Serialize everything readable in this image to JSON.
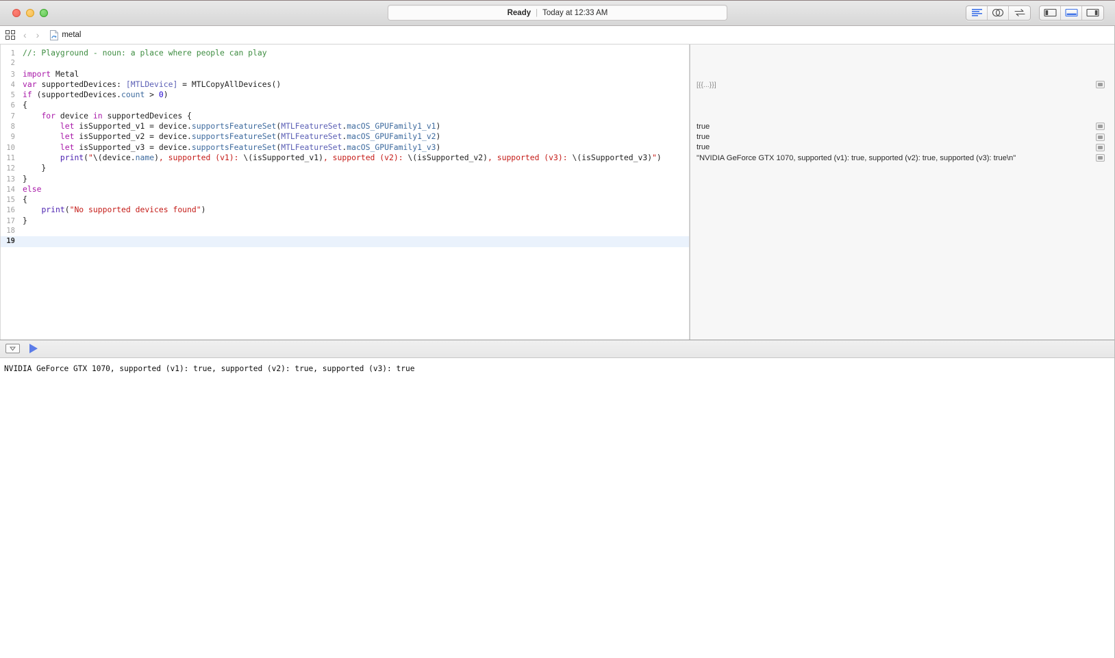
{
  "window": {
    "traffic_lights": [
      "close",
      "minimize",
      "zoom"
    ],
    "status": {
      "state": "Ready",
      "separator": "|",
      "time": "Today at 12:33 AM"
    },
    "toolbar_right": {
      "editor_modes": [
        {
          "name": "standard-editor",
          "icon": "lines-icon",
          "active": true
        },
        {
          "name": "assistant-editor",
          "icon": "two-circles-icon",
          "active": false
        },
        {
          "name": "version-editor",
          "icon": "arrows-swap-icon",
          "active": false
        }
      ],
      "view_toggles": [
        {
          "name": "navigator-toggle",
          "icon": "left-panel-icon",
          "active": false
        },
        {
          "name": "debug-area-toggle",
          "icon": "bottom-panel-icon",
          "active": true
        },
        {
          "name": "utilities-toggle",
          "icon": "right-panel-icon",
          "active": false
        }
      ]
    }
  },
  "pathbar": {
    "grid_icon": "grid-icon",
    "back_label": "‹",
    "forward_label": "›",
    "file_icon": "playground-file-icon",
    "file_name": "metal"
  },
  "editor": {
    "lines": [
      {
        "n": "1",
        "tokens": [
          {
            "t": "//: Playground - noun: a place where people can play",
            "c": "cmt"
          }
        ]
      },
      {
        "n": "2",
        "tokens": []
      },
      {
        "n": "3",
        "tokens": [
          {
            "t": "import ",
            "c": "k"
          },
          {
            "t": "Metal",
            "c": "pln"
          }
        ]
      },
      {
        "n": "4",
        "tokens": [
          {
            "t": "var ",
            "c": "k"
          },
          {
            "t": "supportedDevices: ",
            "c": "pln"
          },
          {
            "t": "[MTLDevice]",
            "c": "ty"
          },
          {
            "t": " = MTLCopyAllDevices()",
            "c": "pln"
          }
        ]
      },
      {
        "n": "5",
        "tokens": [
          {
            "t": "if ",
            "c": "k"
          },
          {
            "t": "(supportedDevices.",
            "c": "pln"
          },
          {
            "t": "count",
            "c": "mth"
          },
          {
            "t": " > ",
            "c": "pln"
          },
          {
            "t": "0",
            "c": "num"
          },
          {
            "t": ")",
            "c": "pln"
          }
        ]
      },
      {
        "n": "6",
        "tokens": [
          {
            "t": "{",
            "c": "pln"
          }
        ]
      },
      {
        "n": "7",
        "tokens": [
          {
            "t": "    ",
            "c": "pln"
          },
          {
            "t": "for ",
            "c": "k"
          },
          {
            "t": "device ",
            "c": "pln"
          },
          {
            "t": "in ",
            "c": "k"
          },
          {
            "t": "supportedDevices {",
            "c": "pln"
          }
        ]
      },
      {
        "n": "8",
        "tokens": [
          {
            "t": "        ",
            "c": "pln"
          },
          {
            "t": "let ",
            "c": "k"
          },
          {
            "t": "isSupported_v1 = device.",
            "c": "pln"
          },
          {
            "t": "supportsFeatureSet",
            "c": "mth"
          },
          {
            "t": "(",
            "c": "pln"
          },
          {
            "t": "MTLFeatureSet",
            "c": "ty"
          },
          {
            "t": ".",
            "c": "pln"
          },
          {
            "t": "macOS_GPUFamily1_v1",
            "c": "mth"
          },
          {
            "t": ")",
            "c": "pln"
          }
        ]
      },
      {
        "n": "9",
        "tokens": [
          {
            "t": "        ",
            "c": "pln"
          },
          {
            "t": "let ",
            "c": "k"
          },
          {
            "t": "isSupported_v2 = device.",
            "c": "pln"
          },
          {
            "t": "supportsFeatureSet",
            "c": "mth"
          },
          {
            "t": "(",
            "c": "pln"
          },
          {
            "t": "MTLFeatureSet",
            "c": "ty"
          },
          {
            "t": ".",
            "c": "pln"
          },
          {
            "t": "macOS_GPUFamily1_v2",
            "c": "mth"
          },
          {
            "t": ")",
            "c": "pln"
          }
        ]
      },
      {
        "n": "10",
        "tokens": [
          {
            "t": "        ",
            "c": "pln"
          },
          {
            "t": "let ",
            "c": "k"
          },
          {
            "t": "isSupported_v3 = device.",
            "c": "pln"
          },
          {
            "t": "supportsFeatureSet",
            "c": "mth"
          },
          {
            "t": "(",
            "c": "pln"
          },
          {
            "t": "MTLFeatureSet",
            "c": "ty"
          },
          {
            "t": ".",
            "c": "pln"
          },
          {
            "t": "macOS_GPUFamily1_v3",
            "c": "mth"
          },
          {
            "t": ")",
            "c": "pln"
          }
        ]
      },
      {
        "n": "11",
        "tokens": [
          {
            "t": "        ",
            "c": "pln"
          },
          {
            "t": "print",
            "c": "fn"
          },
          {
            "t": "(",
            "c": "pln"
          },
          {
            "t": "\"",
            "c": "str"
          },
          {
            "t": "\\(",
            "c": "pln"
          },
          {
            "t": "device.",
            "c": "pln"
          },
          {
            "t": "name",
            "c": "mth"
          },
          {
            "t": ")",
            "c": "pln"
          },
          {
            "t": ", supported (v1): ",
            "c": "str"
          },
          {
            "t": "\\(",
            "c": "pln"
          },
          {
            "t": "isSupported_v1",
            "c": "pln"
          },
          {
            "t": ")",
            "c": "pln"
          },
          {
            "t": ", supported (v2): ",
            "c": "str"
          },
          {
            "t": "\\(",
            "c": "pln"
          },
          {
            "t": "isSupported_v2",
            "c": "pln"
          },
          {
            "t": ")",
            "c": "pln"
          },
          {
            "t": ", supported (v3): ",
            "c": "str"
          },
          {
            "t": "\\(",
            "c": "pln"
          },
          {
            "t": "isSupported_v3",
            "c": "pln"
          },
          {
            "t": ")",
            "c": "pln"
          },
          {
            "t": "\"",
            "c": "str"
          },
          {
            "t": ")",
            "c": "pln"
          }
        ]
      },
      {
        "n": "12",
        "tokens": [
          {
            "t": "    }",
            "c": "pln"
          }
        ]
      },
      {
        "n": "13",
        "tokens": [
          {
            "t": "}",
            "c": "pln"
          }
        ]
      },
      {
        "n": "14",
        "tokens": [
          {
            "t": "else",
            "c": "k"
          }
        ]
      },
      {
        "n": "15",
        "tokens": [
          {
            "t": "{",
            "c": "pln"
          }
        ]
      },
      {
        "n": "16",
        "tokens": [
          {
            "t": "    ",
            "c": "pln"
          },
          {
            "t": "print",
            "c": "fn"
          },
          {
            "t": "(",
            "c": "pln"
          },
          {
            "t": "\"No supported devices found\"",
            "c": "str"
          },
          {
            "t": ")",
            "c": "pln"
          }
        ]
      },
      {
        "n": "17",
        "tokens": [
          {
            "t": "}",
            "c": "pln"
          }
        ]
      },
      {
        "n": "18",
        "tokens": []
      },
      {
        "n": "19",
        "tokens": [],
        "current": true
      }
    ]
  },
  "results": [
    {
      "line": 4,
      "text": "[{{...}}]",
      "muted": true,
      "quicklook": true
    },
    {
      "line": 8,
      "text": "true",
      "muted": false,
      "quicklook": true
    },
    {
      "line": 9,
      "text": "true",
      "muted": false,
      "quicklook": true
    },
    {
      "line": 10,
      "text": "true",
      "muted": false,
      "quicklook": true
    },
    {
      "line": 11,
      "text": "\"NVIDIA GeForce GTX 1070, supported (v1): true, supported (v2): true, supported (v3): true\\n\"",
      "muted": false,
      "quicklook": true
    }
  ],
  "debug": {
    "toggle_icon": "console-toggle-icon",
    "run_icon": "run-play-icon",
    "console_output": "NVIDIA GeForce GTX 1070, supported (v1): true, supported (v2): true, supported (v3): true"
  },
  "colors": {
    "accent_blue": "#3d72e8",
    "run_blue": "#5b7ce8",
    "current_line": "#eaf2fc",
    "comment_green": "#3d8c40",
    "string_red": "#c41a16",
    "keyword_purple": "#a818a8",
    "type_indigo": "#5b5fb5",
    "results_bg": "#f7f7f7"
  }
}
